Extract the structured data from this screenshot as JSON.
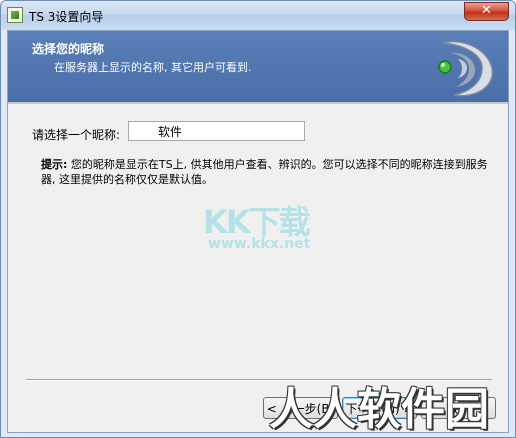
{
  "window": {
    "title": "TS 3设置向导",
    "close_label": "✕"
  },
  "banner": {
    "title": "选择您的昵称",
    "subtitle": "在服务器上显示的名称, 其它用户可看到."
  },
  "form": {
    "nickname_label": "请选择一个昵称:",
    "nickname_value": "软件"
  },
  "hint": {
    "prefix": "提示:",
    "text": " 您的昵称是显示在TS上, 供其他用户查看、辨识的。您可以选择不同的昵称连接到服务器, 这里提供的名称仅仅是默认值。"
  },
  "buttons": {
    "back": "< 上一步(B)",
    "next": "下一步(N) >",
    "cancel": "取消"
  },
  "watermarks": {
    "kk": "KK下载",
    "kk_url": "www.kkx.net",
    "big": "人人软件园"
  },
  "colors": {
    "banner": "#4a6ea8",
    "dialog_bg": "#f0f0f0",
    "logo_dot": "#44c241"
  }
}
